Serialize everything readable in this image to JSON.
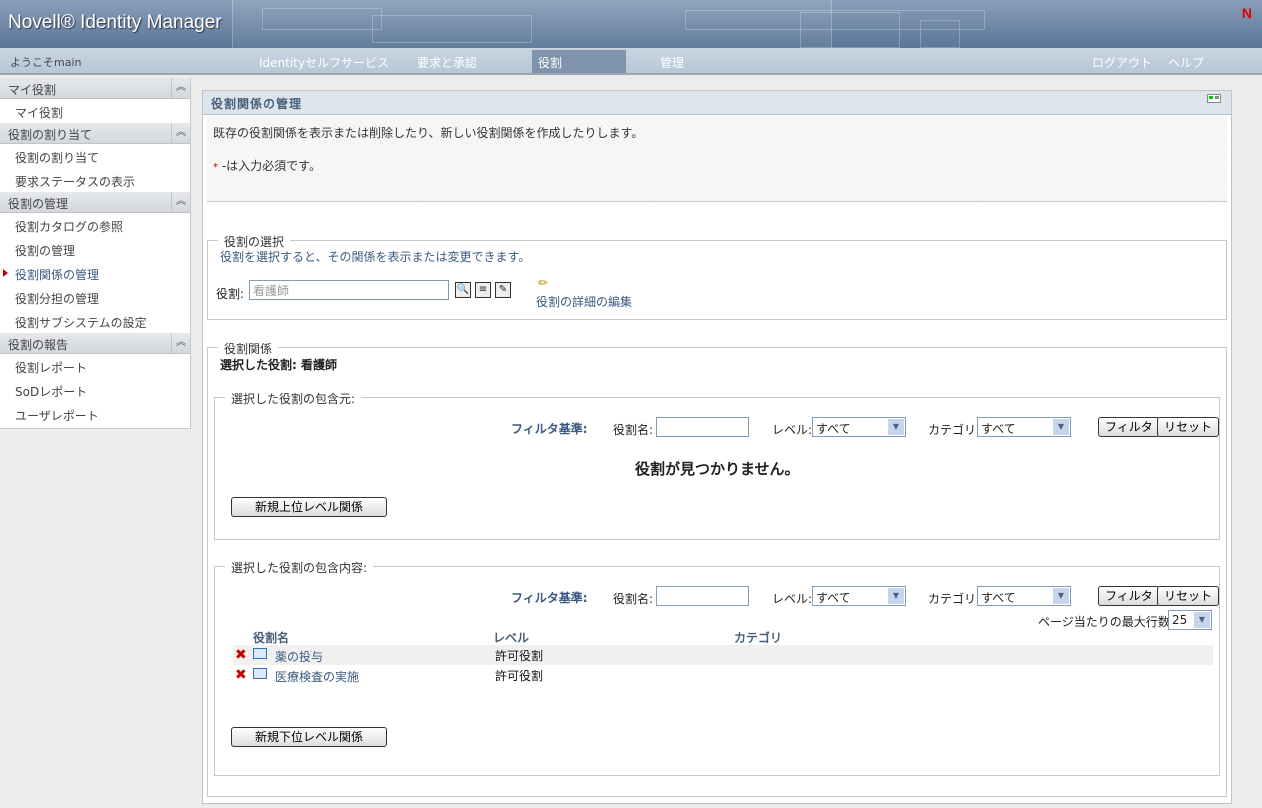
{
  "header": {
    "app_title": "Novell® Identity Manager",
    "brand_mark": "N"
  },
  "nav": {
    "welcome": "ようこそmain",
    "items": [
      "Identityセルフサービス",
      "要求と承認",
      "役割",
      "管理"
    ],
    "active": "役割",
    "logout": "ログアウト",
    "help": "ヘルプ"
  },
  "sidebar": {
    "sections": [
      {
        "title": "マイ役割",
        "items": [
          "マイ役割"
        ]
      },
      {
        "title": "役割の割り当て",
        "items": [
          "役割の割り当て",
          "要求ステータスの表示"
        ]
      },
      {
        "title": "役割の管理",
        "items": [
          "役割カタログの参照",
          "役割の管理",
          "役割関係の管理",
          "役割分担の管理",
          "役割サブシステムの設定"
        ]
      },
      {
        "title": "役割の報告",
        "items": [
          "役割レポート",
          "SoDレポート",
          "ユーザレポート"
        ]
      }
    ],
    "current": "役割関係の管理"
  },
  "page": {
    "title": "役割関係の管理",
    "description": "既存の役割関係を表示または削除したり、新しい役割関係を作成したりします。",
    "required_mark": "*",
    "required_note": "-は入力必須です。"
  },
  "role_select": {
    "legend": "役割の選択",
    "hint": "役割を選択すると、その関係を表示または変更できます。",
    "label": "役割:",
    "value": "看護師",
    "edit_link": "役割の詳細の編集"
  },
  "relations": {
    "legend": "役割関係",
    "selected_label": "選択した役割: 看護師",
    "parents": {
      "legend": "選択した役割の包含元:",
      "filter_label": "フィルタ基準:",
      "name_label": "役割名:",
      "name_value": "",
      "level_label": "レベル:",
      "level_value": "すべて",
      "category_label": "カテゴリ:",
      "category_value": "すべて",
      "filter_btn": "フィルタ",
      "reset_btn": "リセット",
      "empty": "役割が見つかりません。",
      "new_btn": "新規上位レベル関係"
    },
    "children": {
      "legend": "選択した役割の包含内容:",
      "filter_label": "フィルタ基準:",
      "name_label": "役割名:",
      "name_value": "",
      "level_label": "レベル:",
      "level_value": "すべて",
      "category_label": "カテゴリ:",
      "category_value": "すべて",
      "filter_btn": "フィルタ",
      "reset_btn": "リセット",
      "max_rows_label": "ページ当たりの最大行数",
      "max_rows_value": "25",
      "columns": [
        "役割名",
        "レベル",
        "カテゴリ"
      ],
      "rows": [
        {
          "name": "薬の投与",
          "level": "許可役割",
          "category": ""
        },
        {
          "name": "医療検査の実施",
          "level": "許可役割",
          "category": ""
        }
      ],
      "new_btn": "新規下位レベル関係"
    }
  }
}
